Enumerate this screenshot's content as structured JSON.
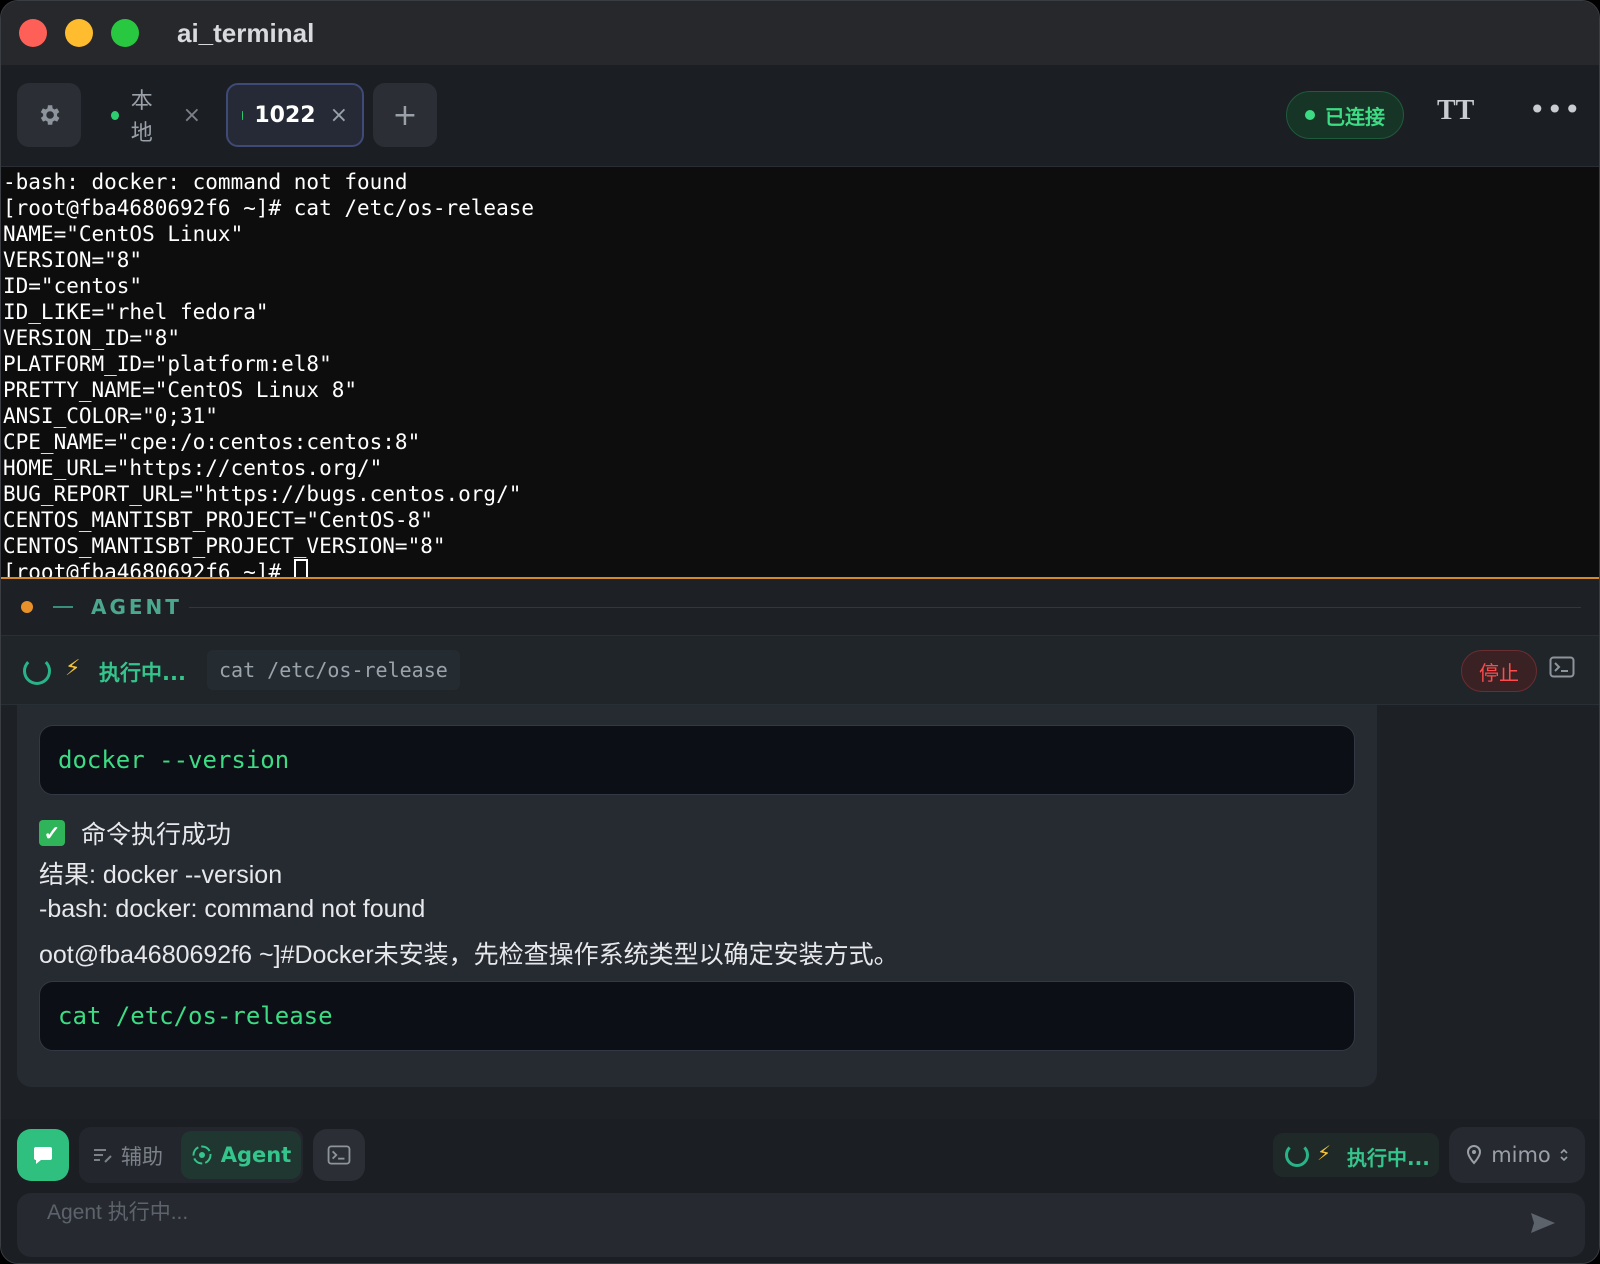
{
  "window": {
    "title": "ai_terminal"
  },
  "tabs": [
    {
      "label": "本地",
      "close": "×",
      "status_color": "#2ecc71"
    },
    {
      "label": "1022",
      "close": "×",
      "status_color": "#2ecc71",
      "active": true
    }
  ],
  "toolbar": {
    "add_tab": "+",
    "connection_status": "已连接",
    "font_size_icon": "TT",
    "more": "•••"
  },
  "terminal": {
    "lines": [
      "-bash: docker: command not found",
      "[root@fba4680692f6 ~]# cat /etc/os-release",
      "NAME=\"CentOS Linux\"",
      "VERSION=\"8\"",
      "ID=\"centos\"",
      "ID_LIKE=\"rhel fedora\"",
      "VERSION_ID=\"8\"",
      "PLATFORM_ID=\"platform:el8\"",
      "PRETTY_NAME=\"CentOS Linux 8\"",
      "ANSI_COLOR=\"0;31\"",
      "CPE_NAME=\"cpe:/o:centos:centos:8\"",
      "HOME_URL=\"https://centos.org/\"",
      "BUG_REPORT_URL=\"https://bugs.centos.org/\"",
      "CENTOS_MANTISBT_PROJECT=\"CentOS-8\"",
      "CENTOS_MANTISBT_PROJECT_VERSION=\"8\""
    ],
    "prompt": "[root@fba4680692f6 ~]# "
  },
  "agent": {
    "section_label": "AGENT",
    "exec_status": "执行中...",
    "current_command": "cat /etc/os-release",
    "stop_label": "停止"
  },
  "message": {
    "code_1": "docker --version",
    "success_mark": "✓",
    "success_text": "命令执行成功",
    "result_line": "结果: docker --version",
    "error_line": "-bash: docker: command not found",
    "explain_line": "oot@fba4680692f6 ~]#Docker未安装，先检查操作系统类型以确定安装方式。",
    "code_2": "cat /etc/os-release"
  },
  "bottom": {
    "mode_assist": "辅助",
    "mode_agent": "Agent",
    "exec_status": "执行中...",
    "model": "mimo",
    "input_placeholder": "Agent 执行中..."
  },
  "colors": {
    "accent_green": "#34c58c",
    "divider_orange": "#d48a2b",
    "stop_red": "#ff4b4b"
  }
}
